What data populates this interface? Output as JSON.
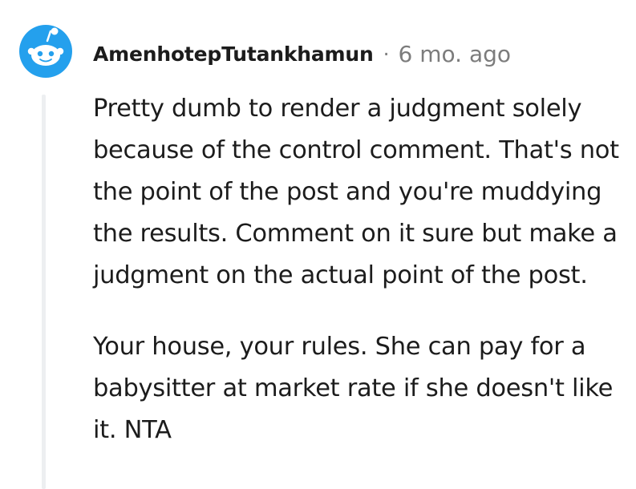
{
  "comment": {
    "username": "AmenhotepTutankhamun",
    "separator": "·",
    "timestamp": "6 mo. ago",
    "paragraphs": [
      "Pretty dumb to render a judgment solely because of the control comment. That's not the point of the post and you're muddying the results. Comment on it sure but make a judgment on the actual point of the post.",
      "Your house, your rules. She can pay for a babysitter at market rate if she doesn't like it. NTA"
    ],
    "avatar_icon": "reddit-snoo-icon",
    "colors": {
      "avatar_bg": "#24a0ed",
      "username": "#1c1c1c",
      "meta": "#7c7c7c",
      "thread_line": "#edeff1"
    }
  }
}
